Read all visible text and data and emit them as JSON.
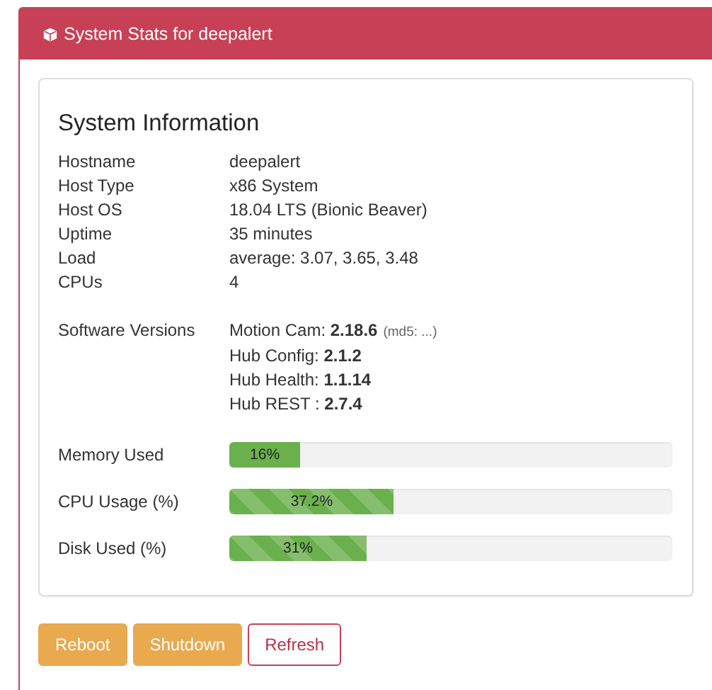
{
  "panel": {
    "title": "System Stats for deepalert"
  },
  "section_title": "System Information",
  "info": [
    {
      "label": "Hostname",
      "value": "deepalert"
    },
    {
      "label": "Host Type",
      "value": "x86 System"
    },
    {
      "label": "Host OS",
      "value": "18.04 LTS (Bionic Beaver)"
    },
    {
      "label": "Uptime",
      "value": "35 minutes"
    },
    {
      "label": "Load",
      "value": "average: 3.07, 3.65, 3.48"
    },
    {
      "label": "CPUs",
      "value": "4"
    }
  ],
  "software": {
    "label": "Software Versions",
    "items": [
      {
        "text": "Motion Cam: **2.18.6**",
        "note": "(md5: ...)"
      },
      {
        "text": "Hub Config: **2.1.2**"
      },
      {
        "text": "Hub Health: **1.1.14**"
      },
      {
        "text": "Hub REST : **2.7.4**"
      }
    ]
  },
  "meters": [
    {
      "label": "Memory Used",
      "level": 0.16,
      "reading": "16%",
      "striped": false
    },
    {
      "label": "CPU Usage (%)",
      "level": 0.372,
      "reading": "37.2%",
      "striped": true
    },
    {
      "label": "Disk Used (%)",
      "level": 0.31,
      "reading": "31%",
      "striped": true
    }
  ],
  "buttons": [
    {
      "label": "Reboot",
      "kind": "warning"
    },
    {
      "label": "Shutdown",
      "kind": "warning"
    },
    {
      "label": "Refresh",
      "kind": "outline"
    }
  ]
}
